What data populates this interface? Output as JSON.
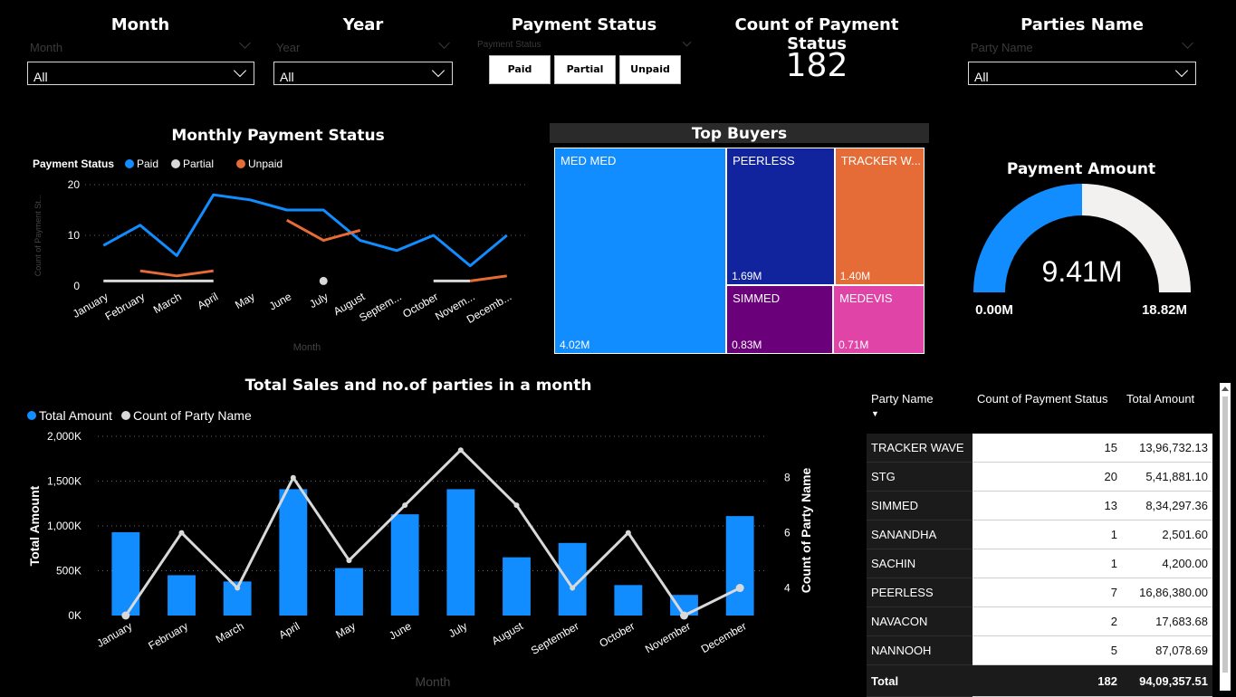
{
  "slicers": {
    "month": {
      "title": "Month",
      "placeholder": "Month",
      "value": "All"
    },
    "year": {
      "title": "Year",
      "placeholder": "Year",
      "value": "All"
    },
    "payment_status": {
      "title": "Payment Status",
      "placeholder": "Payment Status",
      "buttons": [
        "Paid",
        "Partial",
        "Unpaid"
      ]
    },
    "parties": {
      "title": "Parties Name",
      "placeholder": "Party Name",
      "value": "All"
    }
  },
  "count_card": {
    "title": "Count of Payment Status",
    "value": "182"
  },
  "colors": {
    "blue": "#118DFF",
    "gray": "#D9D9D9",
    "orange": "#E66C37",
    "navy": "#12239E",
    "purple": "#6B007B",
    "magenta": "#E044A7"
  },
  "gauge": {
    "title": "Payment Amount",
    "value": 9.41,
    "min": 0,
    "max": 18.82,
    "value_label": "9.41M",
    "min_label": "0.00M",
    "max_label": "18.82M"
  },
  "chart_data": [
    {
      "type": "line",
      "title": "Monthly Payment Status",
      "legend_title": "Payment Status",
      "legend_placement": "top-left",
      "xlabel": "Month",
      "ylabel": "Count of Payment St...",
      "categories": [
        "January",
        "February",
        "March",
        "April",
        "May",
        "June",
        "July",
        "August",
        "Septem...",
        "October",
        "Novem...",
        "Decemb..."
      ],
      "ylim": [
        0,
        20
      ],
      "yticks": [
        "0",
        "10",
        "20"
      ],
      "grid": true,
      "series": [
        {
          "name": "Paid",
          "color": "#118DFF",
          "values": [
            8,
            12,
            6,
            18,
            17,
            15,
            15,
            9,
            7,
            10,
            4,
            10
          ]
        },
        {
          "name": "Partial",
          "color": "#D9D9D9",
          "values": [
            1,
            1,
            1,
            1,
            null,
            null,
            1,
            null,
            null,
            1,
            1,
            null
          ]
        },
        {
          "name": "Unpaid",
          "color": "#E66C37",
          "values": [
            null,
            3,
            2,
            3,
            null,
            13,
            9,
            11,
            null,
            null,
            1,
            2
          ]
        }
      ]
    },
    {
      "type": "treemap",
      "title": "Top Buyers",
      "items": [
        {
          "name": "MED MED",
          "value": 4.02,
          "label": "4.02M",
          "color": "#118DFF"
        },
        {
          "name": "PEERLESS",
          "value": 1.69,
          "label": "1.69M",
          "color": "#12239E"
        },
        {
          "name": "TRACKER W...",
          "value": 1.4,
          "label": "1.40M",
          "color": "#E66C37"
        },
        {
          "name": "SIMMED",
          "value": 0.83,
          "label": "0.83M",
          "color": "#6B007B"
        },
        {
          "name": "MEDEVIS",
          "value": 0.71,
          "label": "0.71M",
          "color": "#E044A7"
        }
      ]
    },
    {
      "type": "bar",
      "title": "Total Sales and no.of parties in a month",
      "legend_placement": "top-left",
      "xlabel": "Month",
      "ylabel": "Total Amount",
      "y2label": "Count of Party Name",
      "categories": [
        "January",
        "February",
        "March",
        "April",
        "May",
        "June",
        "July",
        "August",
        "September",
        "October",
        "November",
        "December"
      ],
      "ylim": [
        0,
        2000
      ],
      "yticks": [
        "0K",
        "500K",
        "1,000K",
        "1,500K",
        "2,000K"
      ],
      "y2lim": [
        3,
        9.5
      ],
      "y2ticks": [
        "4",
        "6",
        "8"
      ],
      "grid": true,
      "series": [
        {
          "name": "Total Amount",
          "color": "#118DFF",
          "type": "bar",
          "values": [
            930,
            450,
            380,
            1410,
            530,
            1130,
            1410,
            650,
            810,
            340,
            230,
            1110
          ]
        },
        {
          "name": "Count of Party Name",
          "color": "#D9D9D9",
          "type": "line",
          "values": [
            3,
            6,
            4,
            8,
            5,
            7,
            9,
            7,
            4,
            6,
            3,
            4
          ]
        }
      ]
    }
  ],
  "table": {
    "headers": [
      "Party Name",
      "Count of Payment Status",
      "Total Amount"
    ],
    "rows": [
      [
        "TRACKER WAVE",
        "15",
        "13,96,732.13"
      ],
      [
        "STG",
        "20",
        "5,41,881.10"
      ],
      [
        "SIMMED",
        "13",
        "8,34,297.36"
      ],
      [
        "SANANDHA",
        "1",
        "2,501.60"
      ],
      [
        "SACHIN",
        "1",
        "4,200.00"
      ],
      [
        "PEERLESS",
        "7",
        "16,86,380.00"
      ],
      [
        "NAVACON",
        "2",
        "17,683.68"
      ],
      [
        "NANNOOH",
        "5",
        "87,078.69"
      ]
    ],
    "total": [
      "Total",
      "182",
      "94,09,357.51"
    ]
  }
}
